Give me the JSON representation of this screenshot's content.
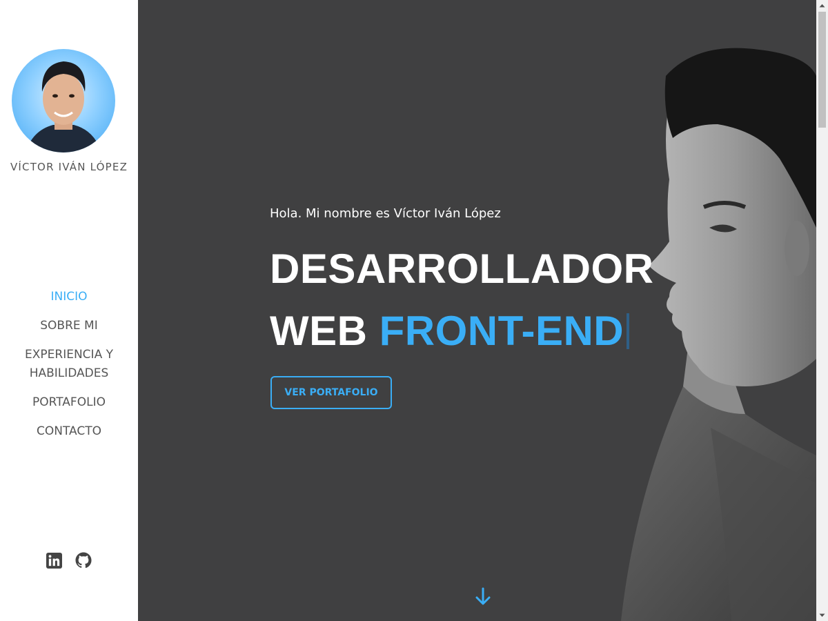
{
  "sidebar": {
    "name": "VÍCTOR IVÁN LÓPEZ",
    "avatar_alt": "avatar",
    "nav": [
      {
        "label": "INICIO",
        "active": true
      },
      {
        "label": "SOBRE MI",
        "active": false
      },
      {
        "label": "EXPERIENCIA Y HABILIDADES",
        "active": false
      },
      {
        "label": "PORTAFOLIO",
        "active": false
      },
      {
        "label": "CONTACTO",
        "active": false
      }
    ],
    "socials": [
      {
        "icon": "linkedin-icon"
      },
      {
        "icon": "github-icon"
      }
    ]
  },
  "hero": {
    "greeting": "Hola. Mi nombre es Víctor Iván López",
    "title_line1": "DESARROLLADOR",
    "title_line2_plain": "WEB",
    "title_line2_accent": "FRONT-END",
    "cta_label": "VER PORTAFOLIO",
    "scroll_icon": "arrow-down-icon"
  },
  "colors": {
    "accent": "#3aaef6",
    "hero_background": "#404041",
    "text_muted": "#555555"
  }
}
